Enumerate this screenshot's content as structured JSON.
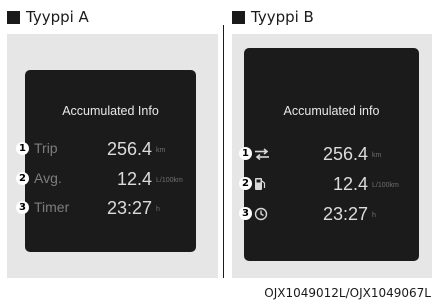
{
  "type_a": {
    "label": "Tyyppi A",
    "title": "Accumulated Info",
    "rows": [
      {
        "badge": "1",
        "label": "Trip",
        "value": "256.4",
        "unit": "km"
      },
      {
        "badge": "2",
        "label": "Avg.",
        "value": "12.4",
        "unit": "L/100km"
      },
      {
        "badge": "3",
        "label": "Timer",
        "value": "23:27",
        "unit": "h"
      }
    ]
  },
  "type_b": {
    "label": "Tyyppi B",
    "title": "Accumulated info",
    "rows": [
      {
        "badge": "1",
        "icon": "trip-arrows-icon",
        "value": "256.4",
        "unit": "km"
      },
      {
        "badge": "2",
        "icon": "fuel-pump-icon",
        "value": "12.4",
        "unit": "L/100km"
      },
      {
        "badge": "3",
        "icon": "clock-icon",
        "value": "23:27",
        "unit": "h"
      }
    ]
  },
  "caption": "OJX1049012L/OJX1049067L",
  "colors": {
    "screen_bg": "#1b1b1b",
    "panel_bg": "#e6e6e6",
    "value_text": "#dcdcdc",
    "label_text": "#7d7d7d",
    "unit_text": "#6f6f6f"
  }
}
